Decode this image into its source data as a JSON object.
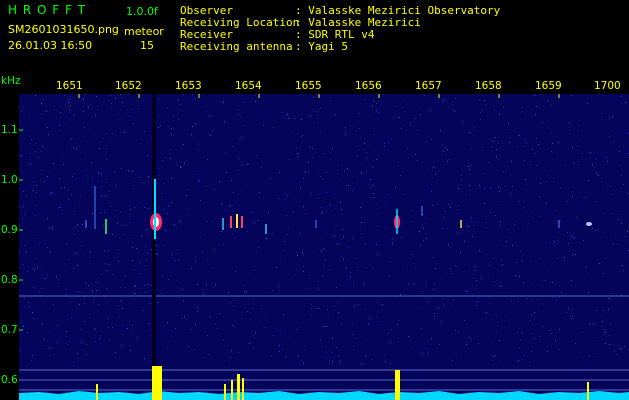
{
  "header": {
    "app_name": "H R O F F T",
    "version": "1.0.0f",
    "filename": "SM2601031650.png",
    "mode_label": "meteor",
    "datetime": "26.01.03 16:50",
    "count": "15"
  },
  "info": [
    {
      "label": "Observer",
      "value": ": Valasske Mezirici Observatory"
    },
    {
      "label": "Receiving Location",
      "value": ": Valasske Mezirici"
    },
    {
      "label": "Receiver",
      "value": ": SDR RTL v4"
    },
    {
      "label": "Receiving antenna",
      "value": ": Yagi 5"
    }
  ],
  "axes": {
    "y_unit": "kHz",
    "x_ticks": [
      "1651",
      "1652",
      "1653",
      "1654",
      "1655",
      "1656",
      "1657",
      "1658",
      "1659",
      "1700"
    ],
    "y_ticks": [
      "1.1",
      "1.0",
      "0.9",
      "0.8",
      "0.7",
      "0.6"
    ]
  },
  "colors": {
    "background": "#000000",
    "header_text": "#ffff00",
    "axis_labels": "#00ff00",
    "spectrogram_bg": "#04045a",
    "noise_floor": "#00d8ff",
    "signal_peak": "#ffff00"
  }
}
